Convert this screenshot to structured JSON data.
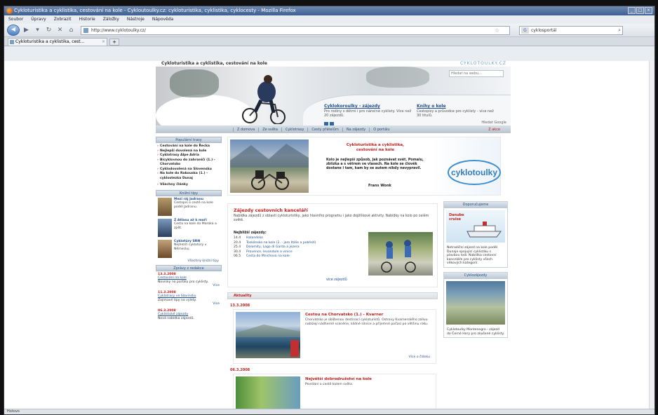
{
  "window": {
    "title": "Cykloturistika a cyklistika, cestování na kole - Cykloutoulky.cz: cykloturistika, cyklistika, cyklocesty - Mozilla Firefox"
  },
  "menu": [
    "Soubor",
    "Úpravy",
    "Zobrazit",
    "Historie",
    "Záložky",
    "Nástroje",
    "Nápověda"
  ],
  "address": {
    "url": "http://www.cyklotoulky.cz/"
  },
  "searchbar": {
    "engine": "Google",
    "value": "cyklosportál"
  },
  "tab": {
    "label": "Cykloturistika a cyklistika, cest..."
  },
  "status": {
    "text": "Hotovo"
  },
  "site": {
    "title": "Cykloturistika a cyklistika, cestování na kole",
    "top_link": "CYKLOTOULKY.CZ",
    "search_placeholder": "Hledat na webu...",
    "promo1": {
      "title": "Cyklokoroulky - zájezdy",
      "text": "Pro rodiny s dětmi i pro náročné cyklisty. Více než 20 zájezdů."
    },
    "promo2": {
      "title": "Knihy o kole",
      "text": "Cestopisy a průvodce pro cyklisty - více než 30 titulů."
    },
    "google": "Hledat Google",
    "nav": [
      "Z domova",
      "Ze světa",
      "Cyklotrasy",
      "Cesty přátelům",
      "Na zájezdy",
      "O portálu"
    ],
    "nav_red": "Z akce"
  },
  "left": {
    "head1": "Populární trasy",
    "items1": [
      "Cestování na kole do Řecka",
      "Nejlepší dovolená na kole",
      "Cyklotrasy Alpe Adria",
      "Bicyklovnou do zahraničí (1.) - Chorvatsko",
      "Cyklodovolená na Slovensku",
      "Na kole do Rakouska (1.) - cyklostezka Dunaj"
    ],
    "item_extra": "Všechny články",
    "head2": "Knižní tipy",
    "books": [
      {
        "title": "Mezi ráj Jadranu",
        "text": "Cestopis o cestě na kole podél Jadranu."
      },
      {
        "title": "Z Atlasu až k moři",
        "text": "Cesta na kole do Maroka a zpět."
      },
      {
        "title": "Cyklotúry SRN",
        "text": "Nejhezčí cyklotúry v Německu."
      }
    ],
    "books_more": "Všechny knižní tipy",
    "head3": "Zprávy z redakce",
    "news": [
      {
        "date": "13.3.2008",
        "title": "Cestování na kole",
        "text": "Novinky na portálu pro cyklisty.",
        "more": "Více"
      },
      {
        "date": "11.3.2008",
        "title": "Cyklotrasy ve Slovinsku",
        "text": "Zajímavé tipy na výlety.",
        "more": "Více"
      },
      {
        "date": "06.3.2008",
        "title": "Cyklistické zájezdy",
        "text": "Nová nabídka zájezdů."
      }
    ]
  },
  "banner": {
    "title": "Cykloturistika a cyklistika, cestování na kole",
    "quote": "Kolo je nejlepší způsob, jak poznávat svět. Pomalu, zblízka a s větrem ve vlasech. Na kole se člověk dostane i tam, kam by se autem nikdy nevypravil.",
    "author": "Frans Wonk",
    "logo": "cyklotoulky"
  },
  "events": {
    "title": "Zájezdy cestovních kanceláří",
    "intro": "Nabídka zájezdů z oblasti cykloturistiky, jako hlavního programu i jako doplňkové aktivity. Nabídky na kolo po celém světě.",
    "label": "Nejbližší zájezdy:",
    "items": [
      {
        "date": "14.4",
        "text": "Holandsko"
      },
      {
        "date": "20.4",
        "text": "Toskánsko na kole (2. - jaro Itálie a pobřeží)"
      },
      {
        "date": "25.4",
        "text": "Dolomity, Lago di Garda a jezera"
      },
      {
        "date": "30.4",
        "text": "Provence, levandule a vinice"
      },
      {
        "date": "06.5",
        "text": "Cesta do Mnichova na kole"
      }
    ],
    "more": "více zájezdů"
  },
  "news_section": {
    "title": "Aktuality"
  },
  "articles": [
    {
      "date": "13.3.2008",
      "title": "Cestou na Chorvatsko (1.) - Kvarner",
      "text": "Chorvatsko je oblíbenou destinací cykloturistů. Ostrovy Kvarnerského zálivu nabízejí nádherné scenérie, klidné silnice a příjemné počasí po většinu roku.",
      "more": "Více o článku"
    },
    {
      "date": "06.3.2008",
      "title": "Největší dobrodružství na kole",
      "text": "Povídání o cestě kolem světa."
    }
  ],
  "right": {
    "head1": "Doporučujeme",
    "ad_label": "Danube cruise",
    "promo": "Netradiční zájezd na kole podél Dunaje spojující cyklistiku s plavbou lodí. Nabídka cestovní kanceláře pro cyklisty všech věkových kategorií.",
    "head2": "Cyklozájezdy",
    "promo2": "Cyklotoulky Montenegro - zájezd do Černé Hory pro zkušené cyklisty."
  }
}
